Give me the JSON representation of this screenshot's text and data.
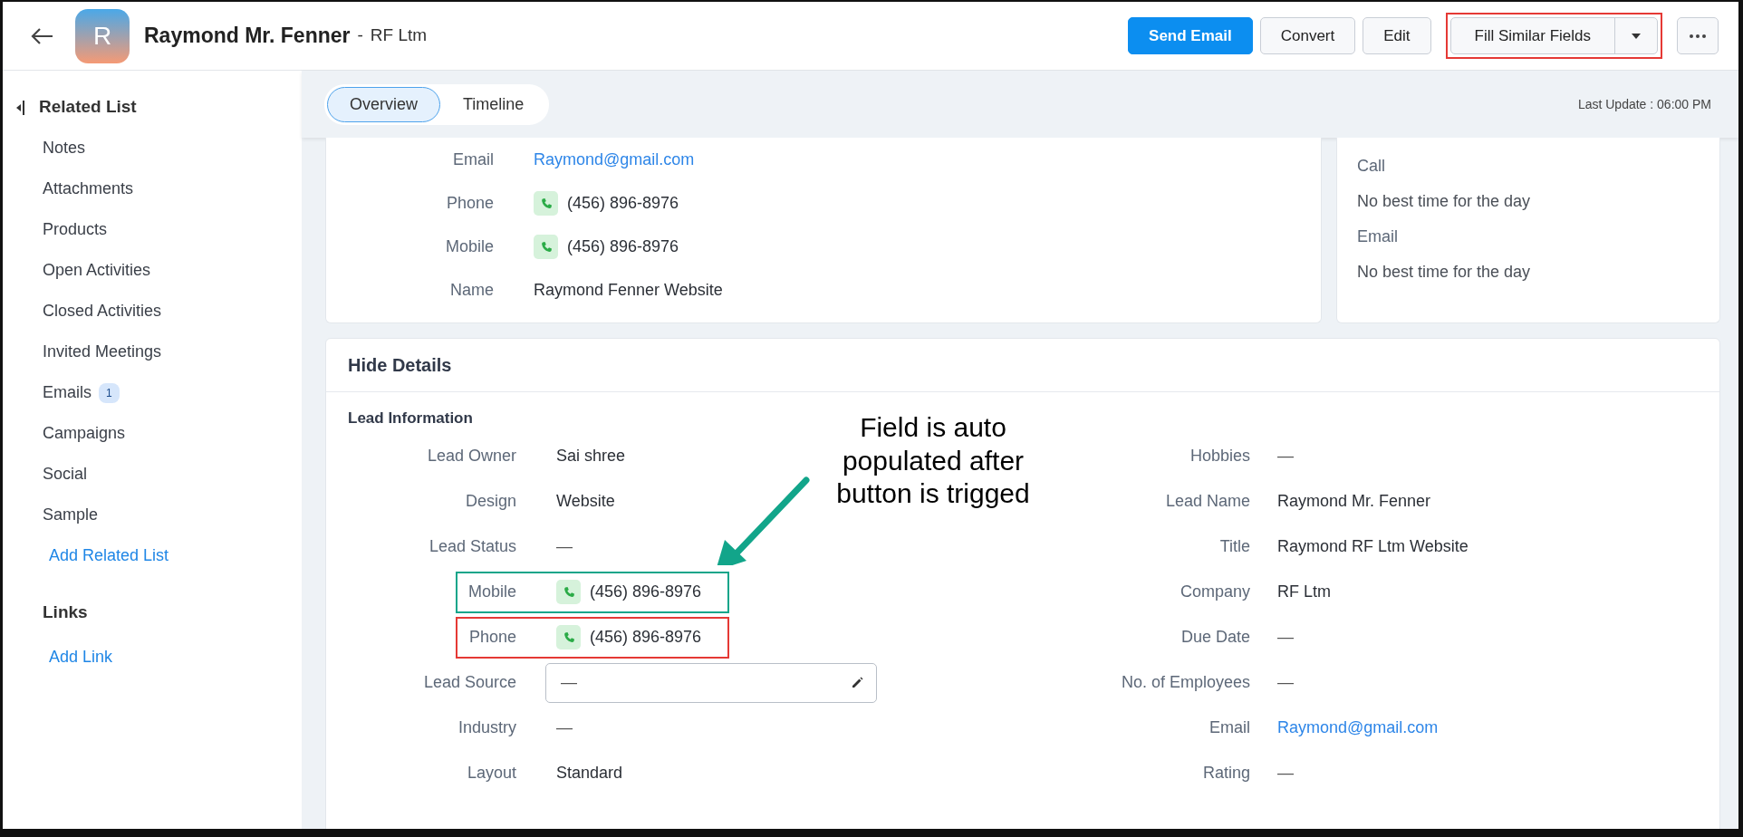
{
  "header": {
    "avatar_letter": "R",
    "name": "Raymond Mr. Fenner",
    "separator": "-",
    "company": "RF Ltm",
    "buttons": [
      {
        "label": "Send Email",
        "kind": "primary"
      },
      {
        "label": "Convert",
        "kind": "default"
      },
      {
        "label": "Edit",
        "kind": "default"
      }
    ],
    "split_button": {
      "label": "Fill Similar Fields",
      "color": "#e53935"
    }
  },
  "sidebar": {
    "title": "Related List",
    "items": [
      {
        "label": "Notes"
      },
      {
        "label": "Attachments"
      },
      {
        "label": "Products"
      },
      {
        "label": "Open Activities"
      },
      {
        "label": "Closed Activities"
      },
      {
        "label": "Invited Meetings"
      },
      {
        "label": "Emails",
        "badge": "1"
      },
      {
        "label": "Campaigns"
      },
      {
        "label": "Social"
      },
      {
        "label": "Sample"
      }
    ],
    "add_related": "Add Related List",
    "links_title": "Links",
    "add_link": "Add Link"
  },
  "tabs": [
    {
      "label": "Overview",
      "selected": true
    },
    {
      "label": "Timeline",
      "selected": false
    }
  ],
  "last_update": "Last Update : 06:00 PM",
  "contact_card": [
    {
      "label": "Email",
      "value": "Raymond@gmail.com",
      "kind": "link"
    },
    {
      "label": "Phone",
      "value": "(456) 896-8976",
      "kind": "phone"
    },
    {
      "label": "Mobile",
      "value": "(456) 896-8976",
      "kind": "phone"
    },
    {
      "label": "Name",
      "value": "Raymond Fenner Website",
      "kind": "text"
    }
  ],
  "best_time_card": [
    {
      "label": "Call",
      "value": "No best time for the day"
    },
    {
      "label": "Email",
      "value": "No best time for the day"
    }
  ],
  "details": {
    "title": "Hide Details",
    "section": "Lead Information",
    "left_fields": [
      {
        "label": "Lead Owner",
        "value": "Sai shree",
        "kind": "text"
      },
      {
        "label": "Design",
        "value": "Website",
        "kind": "text"
      },
      {
        "label": "Lead Status",
        "value": "—",
        "kind": "empty"
      },
      {
        "label": "Mobile",
        "value": "(456) 896-8976",
        "kind": "phone",
        "color": "#12a58a"
      },
      {
        "label": "Phone",
        "value": "(456) 896-8976",
        "kind": "phone",
        "color": "#e53935"
      },
      {
        "label": "Lead Source",
        "value": "—",
        "kind": "input"
      },
      {
        "label": "Industry",
        "value": "—",
        "kind": "empty"
      },
      {
        "label": "Layout",
        "value": "Standard",
        "kind": "text"
      }
    ],
    "right_fields": [
      {
        "label": "Hobbies",
        "value": "—",
        "kind": "empty"
      },
      {
        "label": "Lead Name",
        "value": "Raymond Mr. Fenner",
        "kind": "text"
      },
      {
        "label": "Title",
        "value": "Raymond RF Ltm Website",
        "kind": "text"
      },
      {
        "label": "Company",
        "value": "RF Ltm",
        "kind": "text"
      },
      {
        "label": "Due Date",
        "value": "—",
        "kind": "empty"
      },
      {
        "label": "No. of Employees",
        "value": "—",
        "kind": "empty"
      },
      {
        "label": "Email",
        "value": "Raymond@gmail.com",
        "kind": "link"
      },
      {
        "label": "Rating",
        "value": "—",
        "kind": "empty"
      }
    ]
  },
  "annotation": {
    "text": "Field is auto populated after button is trigged",
    "color": "#12a58a"
  }
}
